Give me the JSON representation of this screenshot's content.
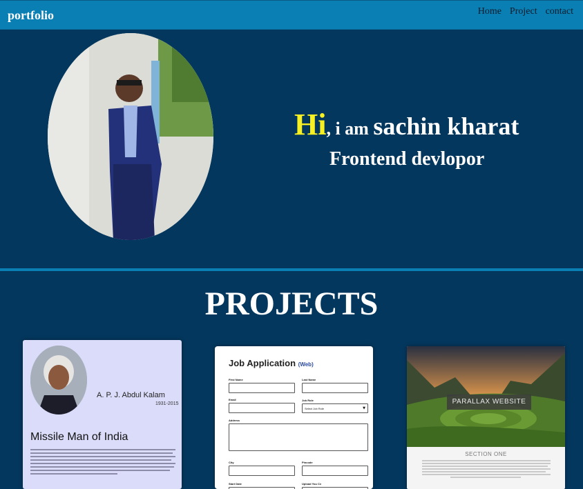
{
  "navbar": {
    "brand": "portfolio",
    "links": [
      "Home",
      "Project",
      "contact"
    ]
  },
  "hero": {
    "hi": "Hi",
    "iam": ", i am ",
    "name": "sachin kharat",
    "role": "Frontend devlopor",
    "avatar_icon": "profile-photo"
  },
  "projects": {
    "title": "PROJECTS",
    "cards": [
      {
        "name": "A. P. J. Abdul Kalam",
        "years": "1931-2015",
        "heading": "Missile Man of India"
      },
      {
        "title": "Job Application",
        "tag": "(Web)",
        "labels": {
          "first_name": "First Name",
          "last_name": "Last Name",
          "email": "Email",
          "job_role": "Job Role",
          "address": "Address",
          "city": "City",
          "pincode": "Pincode",
          "start_date": "Start Date",
          "upload_cv": "Upload You Cv"
        },
        "job_role_value": "Select Job Role"
      },
      {
        "label": "PARALLAX WEBSITE",
        "section": "SECTION ONE"
      }
    ]
  },
  "colors": {
    "background": "#04375d",
    "navbar": "#0a7fb3",
    "accent_hi": "#f8f021"
  }
}
